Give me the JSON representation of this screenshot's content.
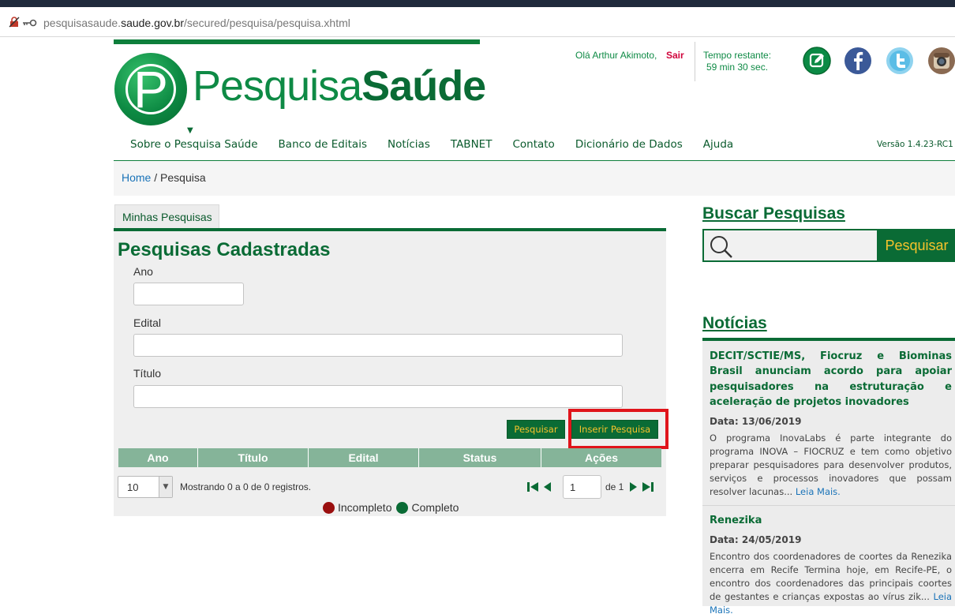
{
  "browser": {
    "url_prefix": "pesquisasaude.",
    "url_domain": "saude.gov.br",
    "url_path": "/secured/pesquisa/pesquisa.xhtml"
  },
  "header": {
    "logo_letter": "P",
    "logo_text_light": "Pesquisa",
    "logo_text_bold": "Saúde",
    "greeting": "Olá Arthur Akimoto,",
    "logout": "Sair",
    "time_label": "Tempo restante:",
    "time_value": "59 min 30 sec.",
    "social_icons": [
      "edit-icon",
      "facebook-icon",
      "twitter-icon",
      "instagram-icon"
    ],
    "version": "Versão 1.4.23-RC1"
  },
  "nav": {
    "items": [
      "Sobre o Pesquisa Saúde",
      "Banco de Editais",
      "Notícias",
      "TABNET",
      "Contato",
      "Dicionário de Dados",
      "Ajuda"
    ]
  },
  "breadcrumb": {
    "home": "Home",
    "separator": " / ",
    "current": "Pesquisa"
  },
  "left": {
    "tab": "Minhas Pesquisas",
    "title": "Pesquisas Cadastradas",
    "fields": {
      "ano": "Ano",
      "edital": "Edital",
      "titulo": "Título"
    },
    "buttons": {
      "search": "Pesquisar",
      "insert": "Inserir Pesquisa"
    },
    "table_headers": [
      "Ano",
      "Título",
      "Edital",
      "Status",
      "Ações"
    ],
    "page_size": "10",
    "showing": "Mostrando 0 a 0 de 0 registros.",
    "page_current": "1",
    "page_of": "de 1",
    "legend": {
      "incomplete": "Incompleto",
      "complete": "Completo"
    }
  },
  "right": {
    "search_title": "Buscar Pesquisas",
    "search_button": "Pesquisar",
    "news_title": "Notícias",
    "news": [
      {
        "headline": "DECIT/SCTIE/MS, Fiocruz e Biominas Brasil anunciam acordo para apoiar pesquisadores na estruturação e aceleração de projetos inovadores",
        "date": "Data: 13/06/2019",
        "text": "O programa InovaLabs é parte integrante do programa INOVA – FIOCRUZ e tem como objetivo preparar pesquisadores para desenvolver produtos, serviços e processos inovadores que possam resolver lacunas...",
        "more": "Leia Mais."
      },
      {
        "headline": "Renezika",
        "date": "Data: 24/05/2019",
        "text": "Encontro dos coordenadores de coortes da Renezika encerra em Recife Termina hoje, em Recife-PE, o encontro dos coordenadores das principais coortes de gestantes e crianças expostas ao vírus zik...",
        "more": "Leia Mais."
      }
    ]
  },
  "colors": {
    "brand_green": "#0a6b35",
    "accent_yellow": "#f7c32b",
    "logout_red": "#d0043c",
    "highlight_red": "#e0141b"
  }
}
